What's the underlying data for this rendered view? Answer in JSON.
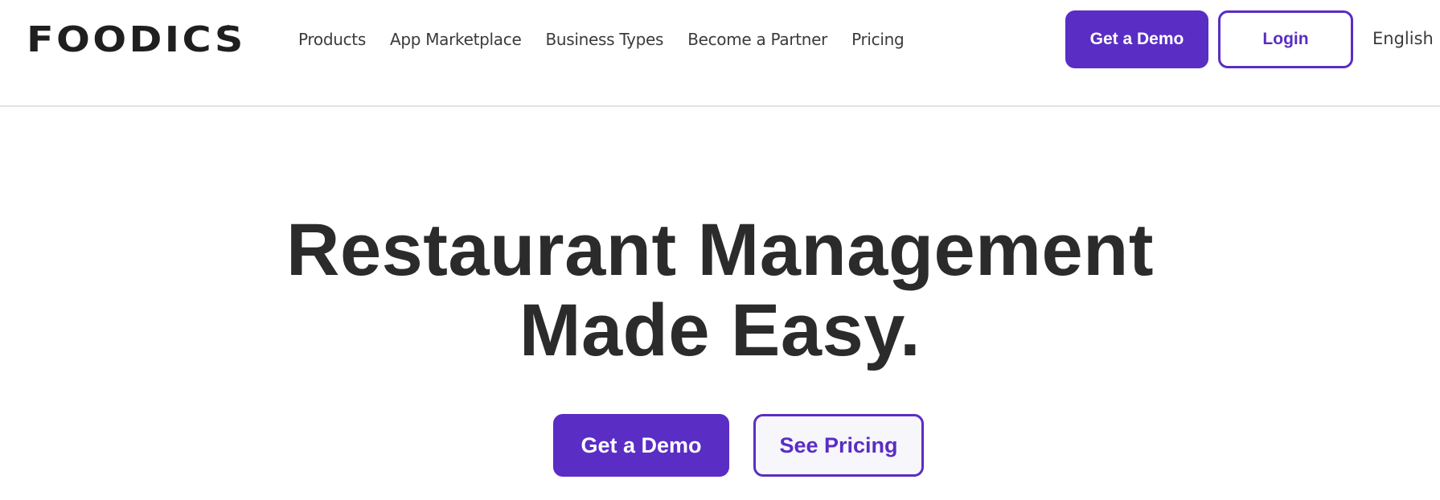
{
  "brand": {
    "logo_text": "FOODICS",
    "logo_mark": "®",
    "accent_color": "#5a2dc4"
  },
  "nav": {
    "items": [
      {
        "label": "Products"
      },
      {
        "label": "App Marketplace"
      },
      {
        "label": "Business Types"
      },
      {
        "label": "Become a Partner"
      },
      {
        "label": "Pricing"
      }
    ]
  },
  "header_actions": {
    "demo_label": "Get a Demo",
    "login_label": "Login",
    "language_label": "English"
  },
  "hero": {
    "title_line_1": "Restaurant Management",
    "title_line_2": "Made Easy.",
    "primary_cta": "Get a Demo",
    "secondary_cta": "See Pricing"
  }
}
